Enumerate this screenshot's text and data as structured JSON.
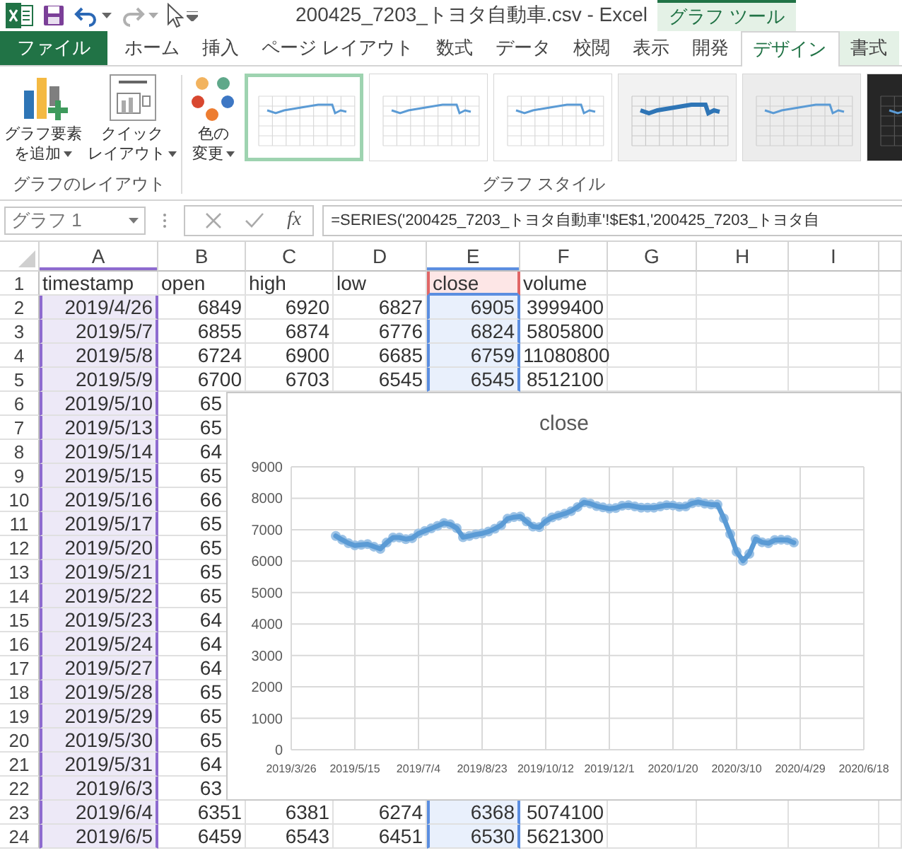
{
  "window": {
    "title": "200425_7203_トヨタ自動車.csv - Excel"
  },
  "context_tab": {
    "label": "グラフ ツール"
  },
  "tabs": [
    {
      "label": "ファイル",
      "kind": "file",
      "selected": false
    },
    {
      "label": "ホーム",
      "kind": "normal",
      "selected": false
    },
    {
      "label": "挿入",
      "kind": "normal",
      "selected": false
    },
    {
      "label": "ページ レイアウト",
      "kind": "normal",
      "selected": false
    },
    {
      "label": "数式",
      "kind": "normal",
      "selected": false
    },
    {
      "label": "データ",
      "kind": "normal",
      "selected": false
    },
    {
      "label": "校閲",
      "kind": "normal",
      "selected": false
    },
    {
      "label": "表示",
      "kind": "normal",
      "selected": false
    },
    {
      "label": "開発",
      "kind": "normal",
      "selected": false
    },
    {
      "label": "デザイン",
      "kind": "context",
      "selected": true
    },
    {
      "label": "書式",
      "kind": "context",
      "selected": false
    }
  ],
  "ribbon": {
    "layout_group": {
      "label": "グラフのレイアウト",
      "buttons": [
        {
          "kind": "add-element",
          "lines": [
            "グラフ要素",
            "を追加"
          ]
        },
        {
          "kind": "quick-layout",
          "lines": [
            "クイック",
            "レイアウト"
          ]
        }
      ]
    },
    "style_group": {
      "label": "グラフ スタイル",
      "color_button": {
        "lines": [
          "色の",
          "変更"
        ]
      },
      "styles": [
        {
          "kind": "plain",
          "selected": true
        },
        {
          "kind": "plain",
          "selected": false
        },
        {
          "kind": "plain",
          "selected": false
        },
        {
          "kind": "shaded",
          "selected": false
        },
        {
          "kind": "gray",
          "selected": false
        },
        {
          "kind": "dark",
          "selected": false
        }
      ]
    }
  },
  "formula_bar": {
    "name_box": "グラフ 1",
    "function_label": "fx",
    "formula": "=SERIES('200425_7203_トヨタ自動車'!$E$1,'200425_7203_トヨタ自"
  },
  "sheet": {
    "columns": [
      {
        "label": "A",
        "category_range": true,
        "values_range": false
      },
      {
        "label": "B",
        "category_range": false,
        "values_range": false
      },
      {
        "label": "C",
        "category_range": false,
        "values_range": false
      },
      {
        "label": "D",
        "category_range": false,
        "values_range": false
      },
      {
        "label": "E",
        "category_range": false,
        "values_range": true
      },
      {
        "label": "F",
        "category_range": false,
        "values_range": false
      },
      {
        "label": "G",
        "category_range": false,
        "values_range": false
      },
      {
        "label": "H",
        "category_range": false,
        "values_range": false
      },
      {
        "label": "I",
        "category_range": false,
        "values_range": false
      }
    ],
    "rows": [
      {
        "number": "1",
        "kind": "header",
        "cells": [
          "timestamp",
          "open",
          "high",
          "low",
          "close",
          "volume"
        ]
      },
      {
        "number": "2",
        "kind": "data",
        "cells": [
          "2019/4/26",
          "6849",
          "6920",
          "6827",
          "6905",
          "3999400"
        ]
      },
      {
        "number": "3",
        "kind": "data",
        "cells": [
          "2019/5/7",
          "6855",
          "6874",
          "6776",
          "6824",
          "5805800"
        ]
      },
      {
        "number": "4",
        "kind": "data",
        "cells": [
          "2019/5/8",
          "6724",
          "6900",
          "6685",
          "6759",
          "11080800"
        ]
      },
      {
        "number": "5",
        "kind": "data",
        "cells": [
          "2019/5/9",
          "6700",
          "6703",
          "6545",
          "6545",
          "8512100"
        ]
      },
      {
        "number": "6",
        "kind": "data",
        "cells": [
          "2019/5/10",
          "65"
        ]
      },
      {
        "number": "7",
        "kind": "data",
        "cells": [
          "2019/5/13",
          "65"
        ]
      },
      {
        "number": "8",
        "kind": "data",
        "cells": [
          "2019/5/14",
          "64"
        ]
      },
      {
        "number": "9",
        "kind": "data",
        "cells": [
          "2019/5/15",
          "65"
        ]
      },
      {
        "number": "10",
        "kind": "data",
        "cells": [
          "2019/5/16",
          "66"
        ]
      },
      {
        "number": "11",
        "kind": "data",
        "cells": [
          "2019/5/17",
          "65"
        ]
      },
      {
        "number": "12",
        "kind": "data",
        "cells": [
          "2019/5/20",
          "65"
        ]
      },
      {
        "number": "13",
        "kind": "data",
        "cells": [
          "2019/5/21",
          "65"
        ]
      },
      {
        "number": "14",
        "kind": "data",
        "cells": [
          "2019/5/22",
          "65"
        ]
      },
      {
        "number": "15",
        "kind": "data",
        "cells": [
          "2019/5/23",
          "64"
        ]
      },
      {
        "number": "16",
        "kind": "data",
        "cells": [
          "2019/5/24",
          "64"
        ]
      },
      {
        "number": "17",
        "kind": "data",
        "cells": [
          "2019/5/27",
          "64"
        ]
      },
      {
        "number": "18",
        "kind": "data",
        "cells": [
          "2019/5/28",
          "65"
        ]
      },
      {
        "number": "19",
        "kind": "data",
        "cells": [
          "2019/5/29",
          "65"
        ]
      },
      {
        "number": "20",
        "kind": "data",
        "cells": [
          "2019/5/30",
          "65"
        ]
      },
      {
        "number": "21",
        "kind": "data",
        "cells": [
          "2019/5/31",
          "64"
        ]
      },
      {
        "number": "22",
        "kind": "data",
        "cells": [
          "2019/6/3",
          "63"
        ]
      },
      {
        "number": "23",
        "kind": "data",
        "cells": [
          "2019/6/4",
          "6351",
          "6381",
          "6274",
          "6368",
          "5074100"
        ]
      },
      {
        "number": "24",
        "kind": "data",
        "cells": [
          "2019/6/5",
          "6459",
          "6543",
          "6451",
          "6530",
          "5621300"
        ]
      }
    ]
  },
  "chart": {
    "chart_data": {
      "type": "line",
      "title": "close",
      "categories": [
        "2019/3/26",
        null,
        null,
        null,
        null,
        null,
        null,
        null,
        null,
        null,
        "2019/5/15",
        null,
        null,
        null,
        null,
        null,
        null,
        null,
        null,
        null,
        "2019/7/4",
        null,
        null,
        null,
        null,
        null,
        null,
        null,
        null,
        null,
        "2019/8/23",
        null,
        null,
        null,
        null,
        null,
        null,
        null,
        null,
        null,
        "2019/10/12",
        null,
        null,
        null,
        null,
        null,
        null,
        null,
        null,
        null,
        "2019/12/1",
        null,
        null,
        null,
        null,
        null,
        null,
        null,
        null,
        null,
        "2020/1/20",
        null,
        null,
        null,
        null,
        null,
        null,
        null,
        null,
        null,
        "2020/3/10",
        null,
        null,
        null,
        null,
        null,
        null,
        null,
        null,
        null,
        "2020/4/29",
        null,
        null,
        null,
        null,
        null,
        null,
        null,
        null,
        null,
        "2020/6/18"
      ],
      "series": [
        {
          "color": "#5b9bd5",
          "marker": true,
          "values": [
            null,
            null,
            null,
            null,
            null,
            null,
            null,
            6800,
            6680,
            6570,
            6500,
            6520,
            6540,
            6460,
            6390,
            6590,
            6750,
            6750,
            6700,
            6730,
            6880,
            6960,
            7040,
            7120,
            7210,
            7170,
            7050,
            6760,
            6800,
            6850,
            6880,
            6940,
            7030,
            7140,
            7350,
            7400,
            7420,
            7260,
            7100,
            7080,
            7270,
            7390,
            7450,
            7510,
            7590,
            7720,
            7870,
            7830,
            7750,
            7710,
            7670,
            7690,
            7760,
            7780,
            7740,
            7700,
            7700,
            7700,
            7740,
            7780,
            7770,
            7730,
            7740,
            7840,
            7880,
            7830,
            7800,
            7800,
            7360,
            6860,
            6300,
            6010,
            6230,
            6700,
            6600,
            6570,
            6670,
            6680,
            6670,
            6590,
            null,
            null,
            null,
            null,
            null,
            null,
            null,
            null,
            null,
            null,
            null
          ]
        }
      ],
      "ylim": [
        0,
        9000
      ],
      "grid": true,
      "yticks": [
        0,
        1000,
        2000,
        3000,
        4000,
        5000,
        6000,
        7000,
        8000,
        9000
      ]
    }
  }
}
